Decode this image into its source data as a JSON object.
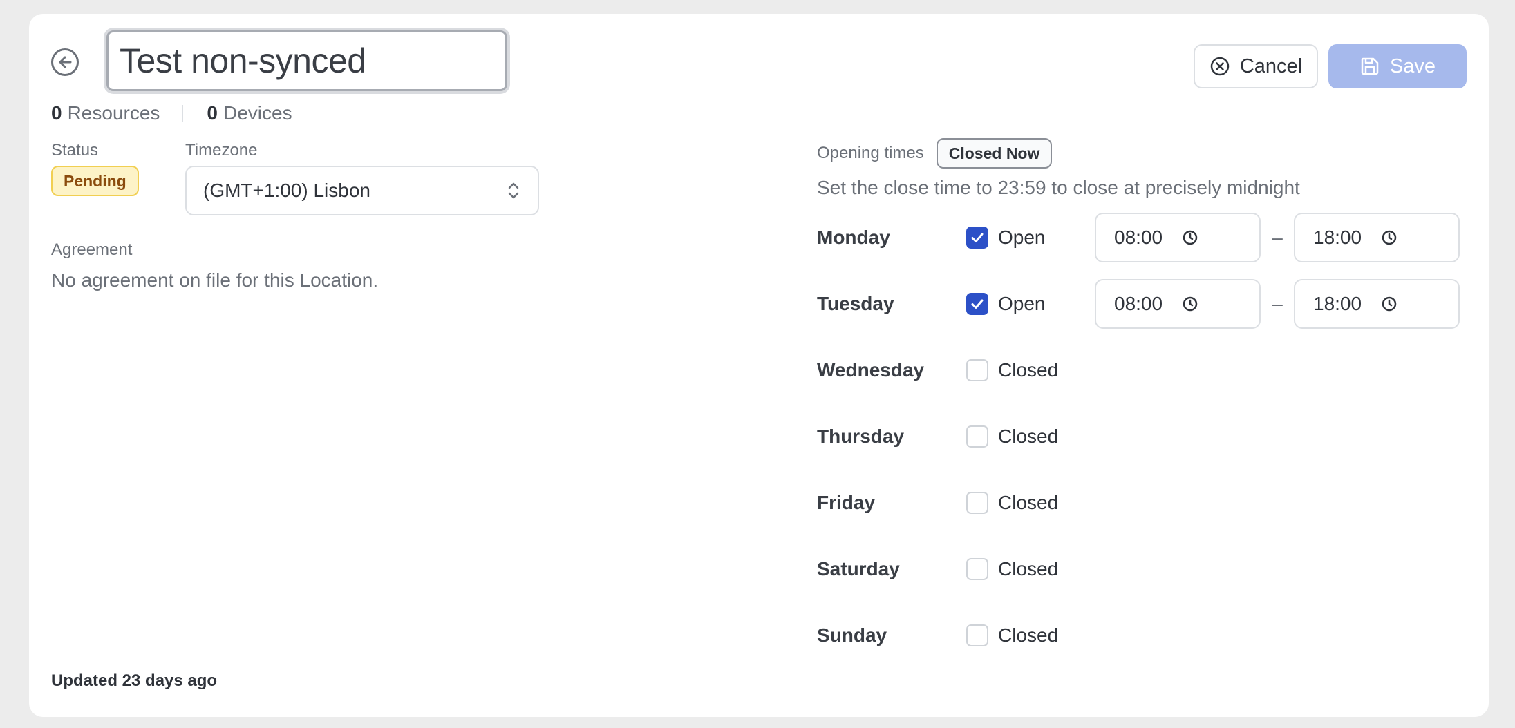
{
  "header": {
    "title_value": "Test non-synced",
    "cancel_label": "Cancel",
    "save_label": "Save"
  },
  "stats": {
    "resources_count": "0",
    "resources_label": "Resources",
    "devices_count": "0",
    "devices_label": "Devices"
  },
  "status": {
    "label": "Status",
    "value": "Pending"
  },
  "timezone": {
    "label": "Timezone",
    "value": "(GMT+1:00) Lisbon"
  },
  "agreement": {
    "label": "Agreement",
    "text": "No agreement on file for this Location."
  },
  "updated": "Updated 23 days ago",
  "opening_times": {
    "label": "Opening times",
    "badge": "Closed Now",
    "hint": "Set the close time to 23:59 to close at precisely midnight",
    "dash": "–",
    "days": [
      {
        "name": "Monday",
        "checked": true,
        "state": "Open",
        "open": "08:00",
        "close": "18:00"
      },
      {
        "name": "Tuesday",
        "checked": true,
        "state": "Open",
        "open": "08:00",
        "close": "18:00"
      },
      {
        "name": "Wednesday",
        "checked": false,
        "state": "Closed"
      },
      {
        "name": "Thursday",
        "checked": false,
        "state": "Closed"
      },
      {
        "name": "Friday",
        "checked": false,
        "state": "Closed"
      },
      {
        "name": "Saturday",
        "checked": false,
        "state": "Closed"
      },
      {
        "name": "Sunday",
        "checked": false,
        "state": "Closed"
      }
    ]
  },
  "colors": {
    "accent": "#2c50c7",
    "save_disabled": "#a6b9ec",
    "pending_bg": "#fdf3c7",
    "pending_border": "#f1cf52"
  },
  "icons": {
    "back": "arrow-left-circle-icon",
    "cancel": "x-circle-icon",
    "save": "floppy-disk-icon",
    "select": "chevron-up-down-icon",
    "clock": "clock-icon",
    "check": "checkmark-icon"
  }
}
